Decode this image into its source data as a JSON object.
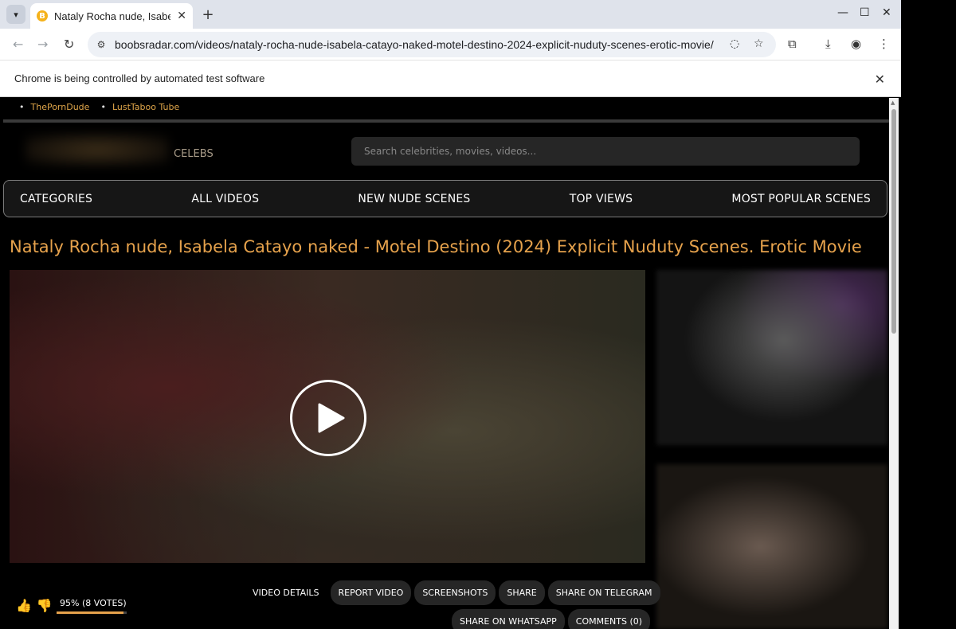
{
  "browser": {
    "tab_title": "Nataly Rocha nude, Isabe",
    "url": "boobsradar.com/videos/nataly-rocha-nude-isabela-catayo-naked-motel-destino-2024-explicit-nuduty-scenes-erotic-movie/",
    "infobar_text": "Chrome is being controlled by automated test software"
  },
  "site": {
    "top_links": [
      "ThePornDude",
      "LustTaboo Tube"
    ],
    "celebs_label": "CELEBS",
    "search_placeholder": "Search celebrities, movies, videos...",
    "nav": [
      "CATEGORIES",
      "ALL VIDEOS",
      "NEW NUDE SCENES",
      "TOP VIEWS",
      "MOST POPULAR SCENES"
    ],
    "title": "Nataly Rocha nude, Isabela Catayo naked - Motel Destino (2024) Explicit Nuduty Scenes. Erotic Movie"
  },
  "rating": {
    "text": "95% (8 VOTES)",
    "percent": 95
  },
  "actions": {
    "row1": [
      "VIDEO DETAILS",
      "REPORT VIDEO",
      "SCREENSHOTS",
      "SHARE",
      "SHARE ON TELEGRAM"
    ],
    "row2": [
      "SHARE ON WHATSAPP",
      "COMMENTS (0)"
    ]
  },
  "colors": {
    "accent": "#e6a24c",
    "nav_bg": "#161616"
  }
}
